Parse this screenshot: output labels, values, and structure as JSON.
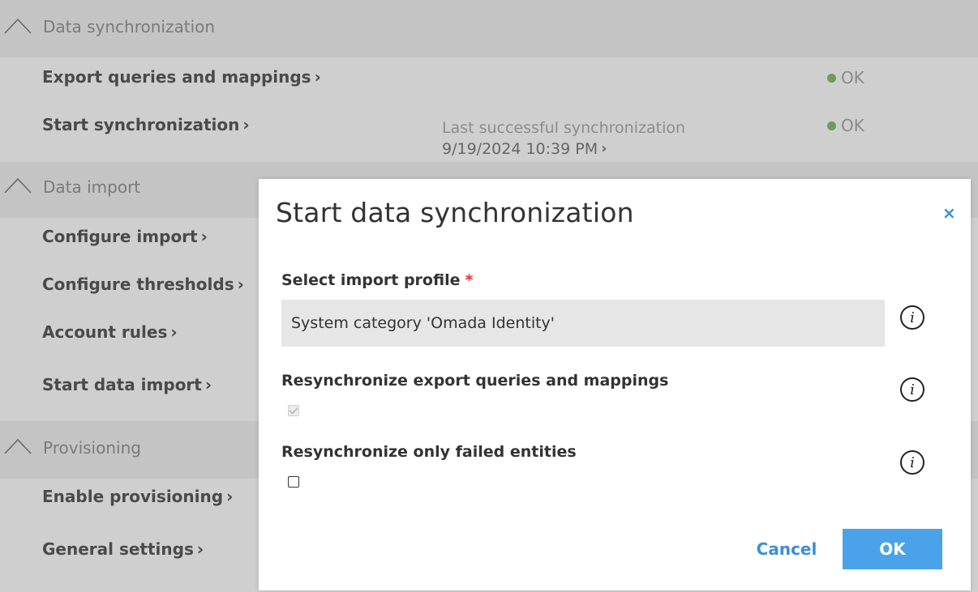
{
  "sections": {
    "data_sync": {
      "title": "Data synchronization",
      "items": {
        "export": {
          "label": "Export queries and mappings",
          "status": "OK"
        },
        "start_sync": {
          "label": "Start synchronization",
          "last_label": "Last successful synchronization",
          "last_value": "9/19/2024 10:39 PM",
          "status": "OK"
        }
      }
    },
    "data_import": {
      "title": "Data import",
      "items": {
        "configure_import": "Configure import",
        "configure_thresholds": "Configure thresholds",
        "account_rules": "Account rules",
        "start_data_import": "Start data import"
      }
    },
    "provisioning": {
      "title": "Provisioning",
      "items": {
        "enable": "Enable provisioning",
        "general": "General settings"
      }
    }
  },
  "modal": {
    "title": "Start data synchronization",
    "close_glyph": "×",
    "profile_label": "Select import profile",
    "required_mark": "*",
    "profile_value": "System category 'Omada Identity'",
    "resync_label": "Resynchronize export queries and mappings",
    "resync_checked": true,
    "failed_label": "Resynchronize only failed entities",
    "failed_checked": false,
    "cancel_label": "Cancel",
    "ok_label": "OK"
  },
  "glyphs": {
    "chevron_right": "›",
    "info": "i"
  },
  "colors": {
    "accent": "#4aa3ea",
    "status_ok": "#6e9a5e",
    "required": "#dd3333"
  }
}
